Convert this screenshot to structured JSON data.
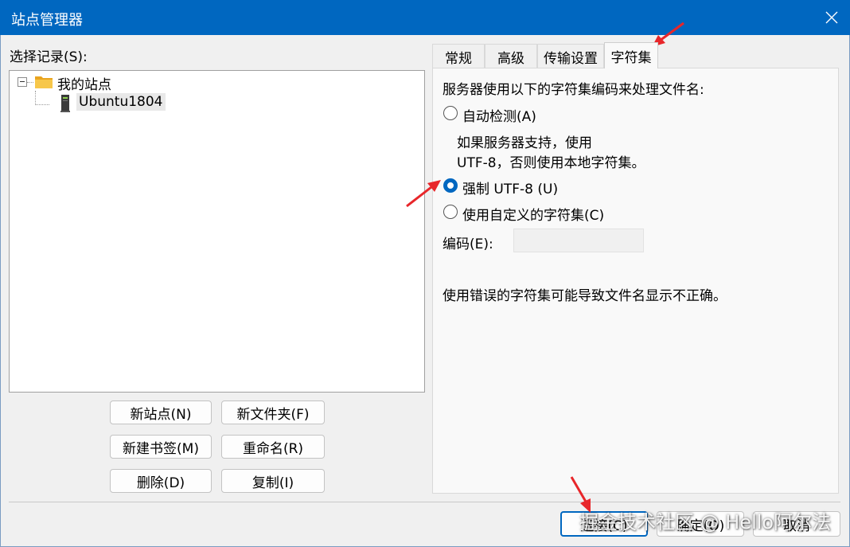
{
  "window": {
    "title": "站点管理器"
  },
  "left": {
    "select_label": "选择记录(S):",
    "tree": {
      "root": "我的站点",
      "site": "Ubuntu1804"
    },
    "buttons": {
      "new_site": "新站点(N)",
      "new_folder": "新文件夹(F)",
      "new_bookmark": "新建书签(M)",
      "rename": "重命名(R)",
      "delete": "删除(D)",
      "duplicate": "复制(I)"
    }
  },
  "tabs": [
    "常规",
    "高级",
    "传输设置",
    "字符集"
  ],
  "active_tab": "字符集",
  "charset": {
    "heading": "服务器使用以下的字符集编码来处理文件名:",
    "auto_detect": "自动检测(A)",
    "auto_desc_line1": "如果服务器支持，使用",
    "auto_desc_line2": "UTF-8，否则使用本地字符集。",
    "force_utf8": "强制 UTF-8 (U)",
    "custom": "使用自定义的字符集(C)",
    "selected": "force_utf8",
    "encoding_label": "编码(E):",
    "encoding_value": "",
    "warning": "使用错误的字符集可能导致文件名显示不正确。"
  },
  "footer": {
    "connect": "连接(C)",
    "ok": "确定(O)",
    "cancel": "取消"
  },
  "watermark": "掘金技术社区 @ Hello阿尔法",
  "colors": {
    "titlebar": "#0067c0",
    "radio_checked": "#0067c0",
    "annotation_arrow": "#e8262a",
    "folder": "#f2b632"
  }
}
